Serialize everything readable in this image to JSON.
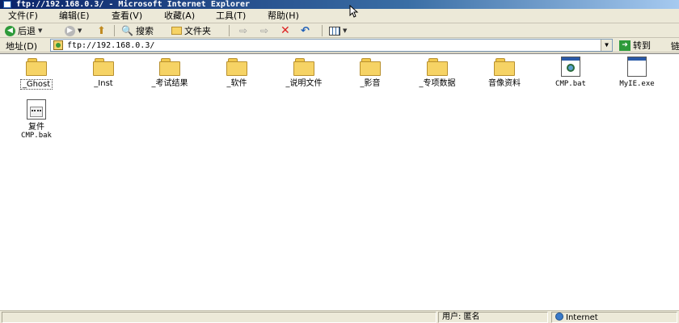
{
  "window": {
    "title": "ftp://192.168.0.3/ - Microsoft Internet Explorer"
  },
  "menu": {
    "items": [
      "文件(F)",
      "编辑(E)",
      "查看(V)",
      "收藏(A)",
      "工具(T)",
      "帮助(H)"
    ]
  },
  "toolbar": {
    "back_label": "后退",
    "search_label": "搜索",
    "folders_label": "文件夹"
  },
  "address": {
    "label": "地址(D)",
    "value": "ftp://192.168.0.3/",
    "go_label": "转到",
    "links_stub": "链"
  },
  "files": [
    {
      "name": "_Ghost",
      "type": "folder"
    },
    {
      "name": "_Inst",
      "type": "folder"
    },
    {
      "name": "_考试结果",
      "type": "folder"
    },
    {
      "name": "_软件",
      "type": "folder"
    },
    {
      "name": "_说明文件",
      "type": "folder"
    },
    {
      "name": "_影音",
      "type": "folder"
    },
    {
      "name": "_专项数据",
      "type": "folder"
    },
    {
      "name": "音像资料",
      "type": "folder"
    },
    {
      "name": "CMP.bat",
      "type": "bat-file"
    },
    {
      "name": "MyIE.exe",
      "type": "exe-file"
    },
    {
      "name": "复件 CMP.bak",
      "name_line1": "复件",
      "name_line2": "CMP.bak",
      "type": "bak-file"
    }
  ],
  "status": {
    "user": "用户: 匿名",
    "zone": "Internet"
  }
}
